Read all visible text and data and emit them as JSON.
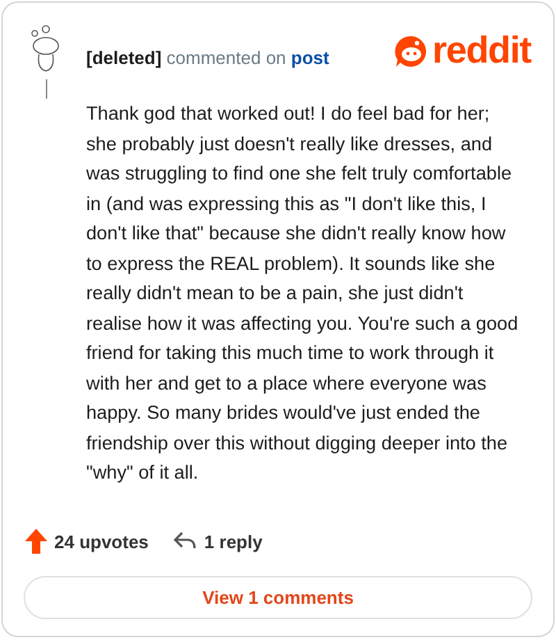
{
  "header": {
    "author": "[deleted]",
    "action": "commented on",
    "target": "post",
    "logo": "reddit"
  },
  "comment": {
    "body": "Thank god that worked out! I do feel bad for her; she probably just doesn't really like dresses, and was struggling to find one she felt truly comfortable in (and was expressing this as \"I don't like this, I don't like that\" because she didn't really know how to express the REAL problem). It sounds like she really didn't mean to be a pain, she just didn't realise how it was affecting you. You're such a good friend for taking this much time to work through it with her and get to a place where everyone was happy. So many brides would've just ended the friendship over this without digging deeper into the \"why\" of it all."
  },
  "actions": {
    "upvotes": "24 upvotes",
    "replies": "1 reply"
  },
  "button": "View 1 comments"
}
